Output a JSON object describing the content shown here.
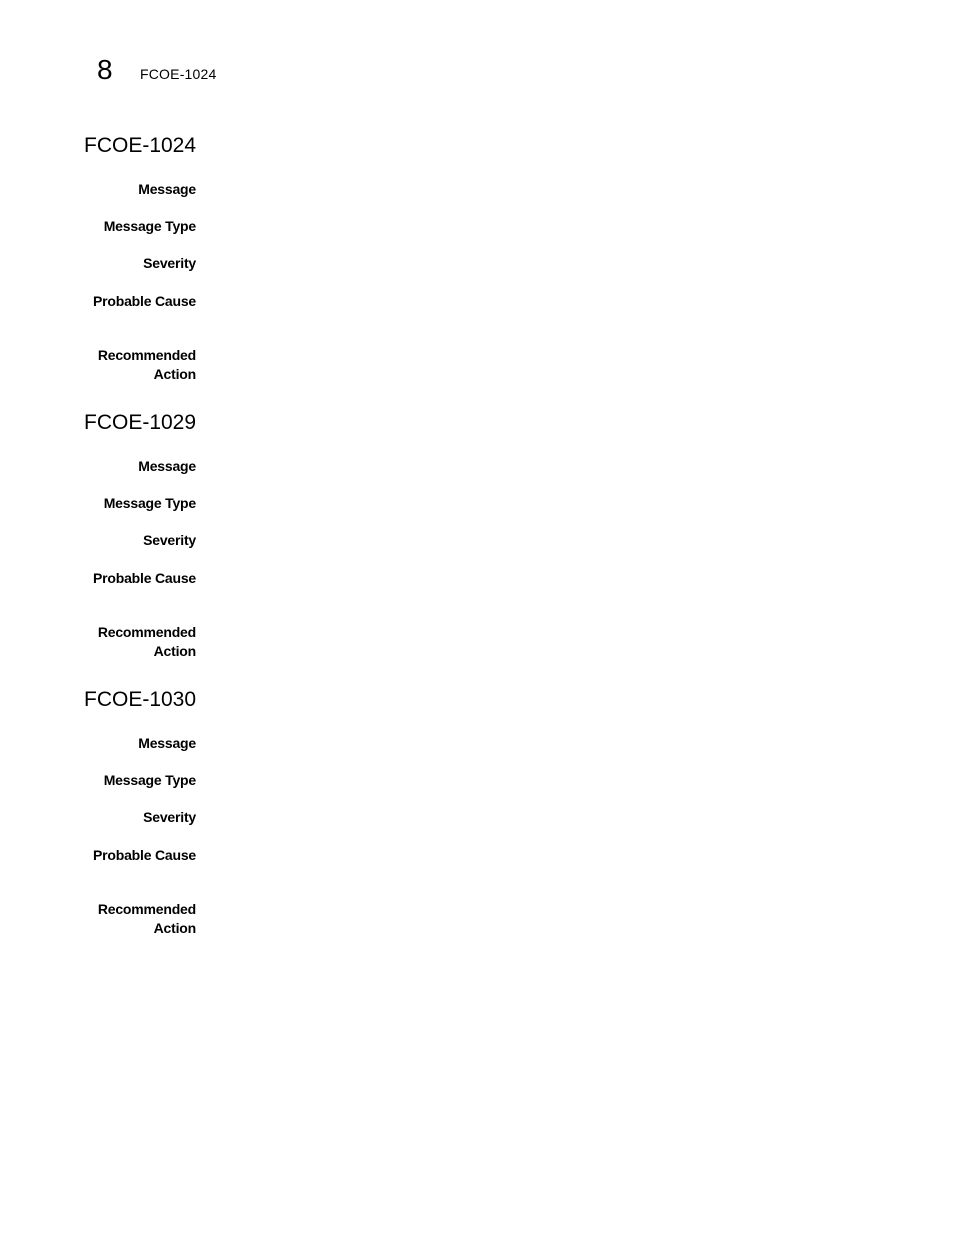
{
  "header": {
    "chapter_number": "8",
    "running_title": "FCOE-1024"
  },
  "sections": [
    {
      "title": "FCOE-1024",
      "fields": {
        "message": {
          "label": "Message",
          "value": ""
        },
        "message_type": {
          "label": "Message Type",
          "value": ""
        },
        "severity": {
          "label": "Severity",
          "value": ""
        },
        "probable_cause": {
          "label": "Probable Cause",
          "value": ""
        },
        "recommended_action": {
          "label_line1": "Recommended",
          "label_line2": "Action",
          "value": ""
        }
      }
    },
    {
      "title": "FCOE-1029",
      "fields": {
        "message": {
          "label": "Message",
          "value": ""
        },
        "message_type": {
          "label": "Message Type",
          "value": ""
        },
        "severity": {
          "label": "Severity",
          "value": ""
        },
        "probable_cause": {
          "label": "Probable Cause",
          "value": ""
        },
        "recommended_action": {
          "label_line1": "Recommended",
          "label_line2": "Action",
          "value": ""
        }
      }
    },
    {
      "title": "FCOE-1030",
      "fields": {
        "message": {
          "label": "Message",
          "value": ""
        },
        "message_type": {
          "label": "Message Type",
          "value": ""
        },
        "severity": {
          "label": "Severity",
          "value": ""
        },
        "probable_cause": {
          "label": "Probable Cause",
          "value": ""
        },
        "recommended_action": {
          "label_line1": "Recommended",
          "label_line2": "Action",
          "value": ""
        }
      }
    }
  ]
}
